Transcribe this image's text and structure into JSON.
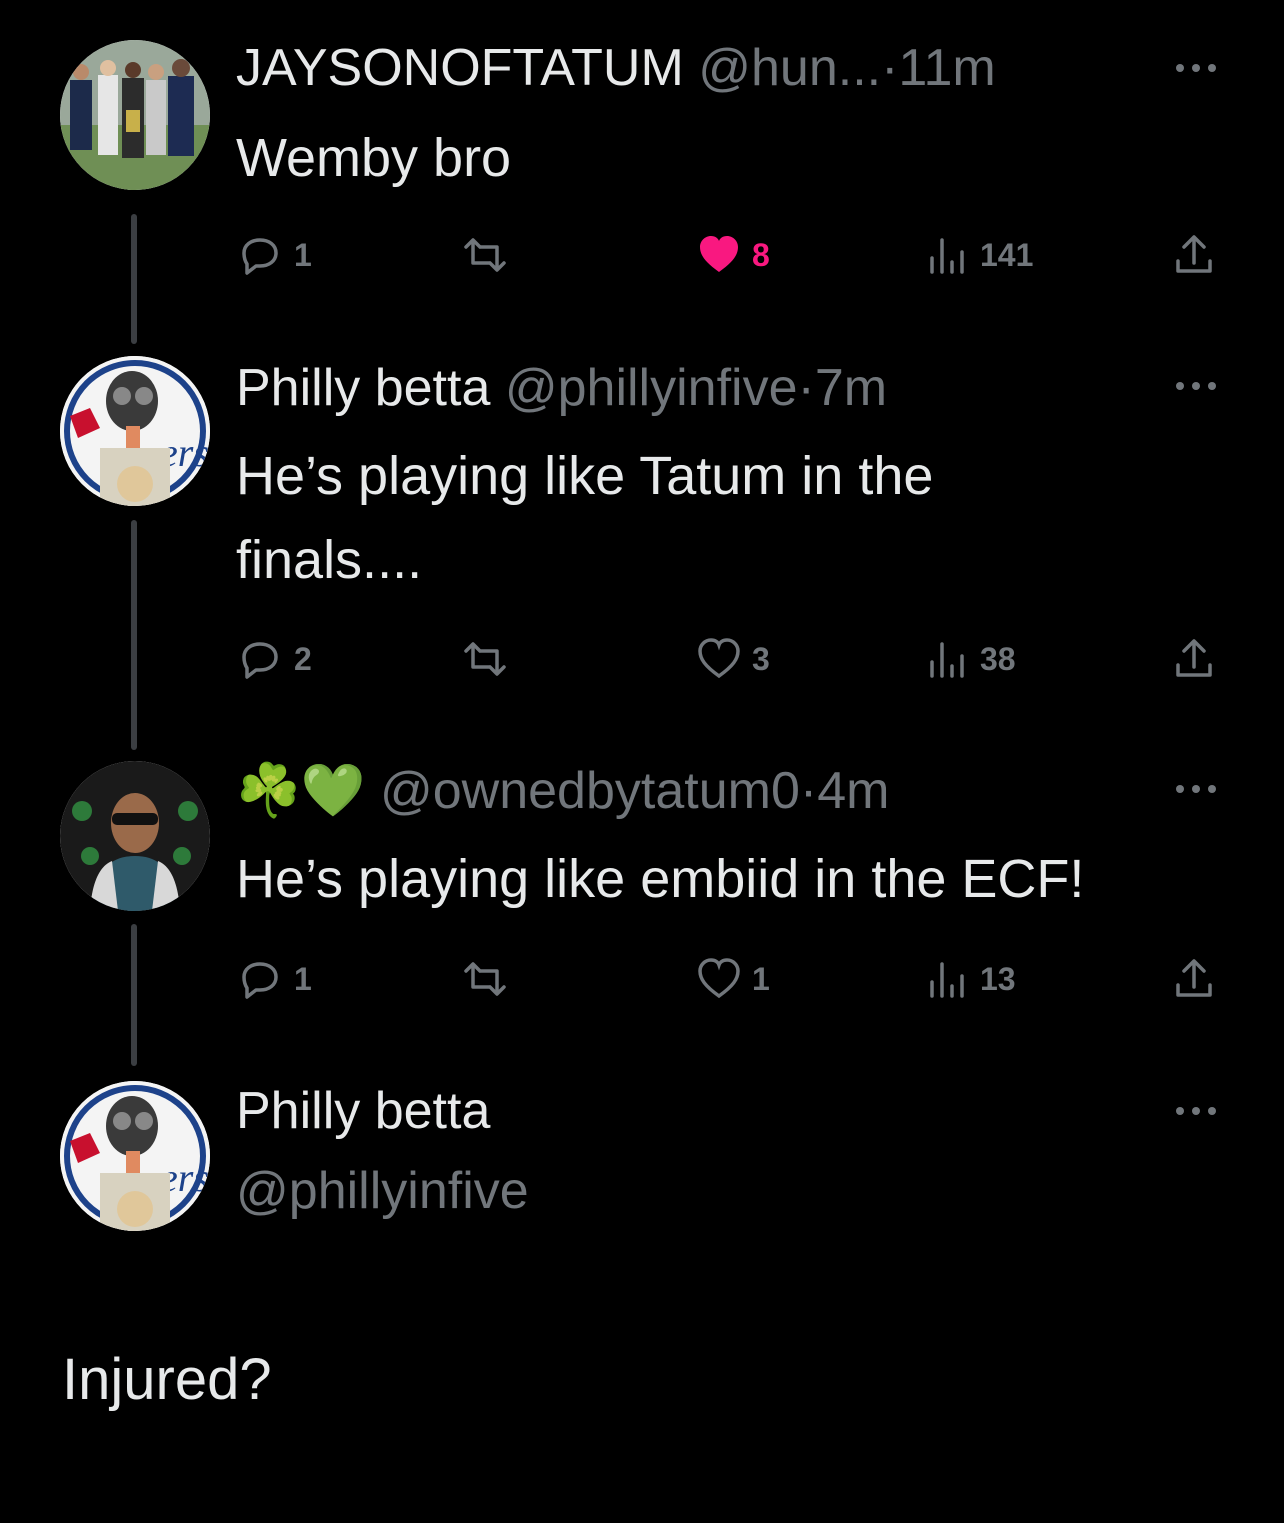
{
  "tweets": [
    {
      "name": "JAYSONOFTATUM",
      "handle": "@hun...",
      "time": "·11m",
      "text": "Wemby bro",
      "replies": "1",
      "likes": "8",
      "liked": true,
      "views": "141"
    },
    {
      "name": "Philly betta",
      "handle": "@phillyinfive",
      "time": "·7m",
      "text_line1": "He’s playing like Tatum in the",
      "text_line2": "finals....",
      "replies": "2",
      "likes": "3",
      "liked": false,
      "views": "38"
    },
    {
      "name_emoji": "☘️💚",
      "handle": "@ownedbytatum0",
      "time": "·4m",
      "text": "He’s playing like embiid in the ECF!",
      "replies": "1",
      "likes": "1",
      "liked": false,
      "views": "13"
    }
  ],
  "composer": {
    "name": "Philly betta",
    "handle": "@phillyinfive",
    "text": "Injured?"
  },
  "colors": {
    "background": "#000000",
    "text": "#e7e9ea",
    "muted": "#71767b",
    "like": "#f91880",
    "thread_line": "#3b3e42"
  },
  "icons": [
    "reply-icon",
    "retweet-icon",
    "like-icon",
    "views-icon",
    "share-icon",
    "more-icon"
  ]
}
